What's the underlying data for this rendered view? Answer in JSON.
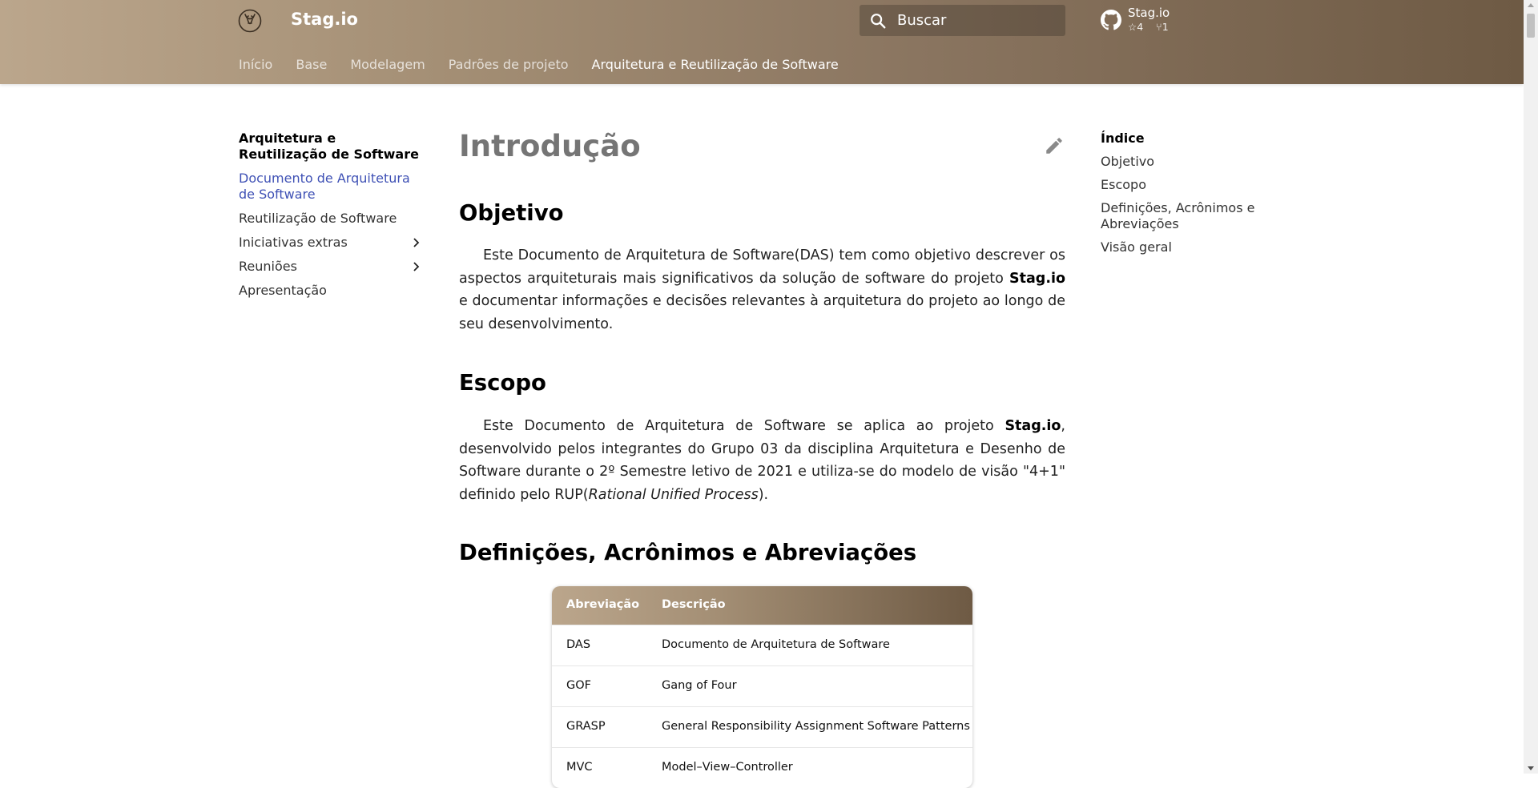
{
  "header": {
    "site_title": "Stag.io",
    "logo_icon": "stag-logo-icon",
    "search": {
      "placeholder": "Buscar",
      "icon": "search-icon"
    },
    "repo": {
      "name": "Stag.io",
      "stars": "4",
      "forks": "1",
      "icon": "github-icon"
    },
    "nav_tabs": [
      {
        "label": "Início",
        "active": false
      },
      {
        "label": "Base",
        "active": false
      },
      {
        "label": "Modelagem",
        "active": false
      },
      {
        "label": "Padrões de projeto",
        "active": false
      },
      {
        "label": "Arquitetura e Reutilização de Software",
        "active": true
      }
    ],
    "colors": {
      "gradient_start": "#bba68c",
      "gradient_end": "#6e5a44"
    }
  },
  "sidebar": {
    "title": "Arquitetura e Reutilização de Software",
    "items": [
      {
        "label": "Documento de Arquitetura de Software",
        "active": true,
        "expandable": false
      },
      {
        "label": "Reutilização de Software",
        "active": false,
        "expandable": false
      },
      {
        "label": "Iniciativas extras",
        "active": false,
        "expandable": true
      },
      {
        "label": "Reuniões",
        "active": false,
        "expandable": true
      },
      {
        "label": "Apresentação",
        "active": false,
        "expandable": false
      }
    ],
    "active_color": "#3f51b5"
  },
  "main": {
    "title": "Introdução",
    "edit_icon": "pencil-icon",
    "sections": {
      "objetivo": {
        "heading": "Objetivo",
        "text_before": "Este Documento de Arquitetura de Software(DAS) tem como objetivo descrever os aspectos arquiteturais mais significativos da solução de software do projeto ",
        "bold": "Stag.io",
        "text_after": " e documentar informações e decisões relevantes à arquitetura do projeto ao longo de seu desenvolvimento."
      },
      "escopo": {
        "heading": "Escopo",
        "text_before": "Este Documento de Arquitetura de Software se aplica ao projeto ",
        "bold": "Stag.io",
        "text_middle": ", desenvolvido pelos integrantes do Grupo 03 da disciplina Arquitetura e Desenho de Software durante o 2º Semestre letivo de 2021 e utiliza-se do modelo de visão \"4+1\" definido pelo RUP(",
        "italic": "Rational Unified Process",
        "text_after": ")."
      },
      "definicoes": {
        "heading": "Definições, Acrônimos e Abreviações",
        "table": {
          "headers": [
            "Abreviação",
            "Descrição"
          ],
          "rows": [
            [
              "DAS",
              "Documento de Arquitetura de Software"
            ],
            [
              "GOF",
              "Gang of Four"
            ],
            [
              "GRASP",
              "General Responsibility Assignment Software Patterns"
            ],
            [
              "MVC",
              "Model–View–Controller"
            ]
          ]
        }
      }
    }
  },
  "toc": {
    "title": "Índice",
    "items": [
      "Objetivo",
      "Escopo",
      "Definições, Acrônimos e Abreviações",
      "Visão geral"
    ]
  }
}
